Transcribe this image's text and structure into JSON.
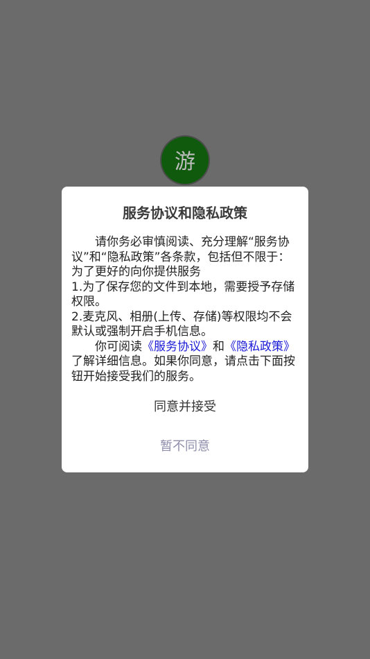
{
  "app": {
    "logo_text": "游"
  },
  "dialog": {
    "title": "服务协议和隐私政策",
    "paragraph1": "请你务必审慎阅读、充分理解“服务协议”和“隐私政策”各条款，包括但不限于：为了更好的向你提供服务",
    "line_storage": "1.为了保存您的文件到本地，需要授予存储权限。",
    "line_permissions": "2.麦克风、相册(上传、存储)等权限均不会默认或强制开启手机信息。",
    "read_prefix": "你可阅读",
    "service_link": "《服务协议》",
    "and_text": "和",
    "privacy_link": "《隐私政策》",
    "read_suffix": "了解详细信息。如果你同意，请点击下面按钮开始接受我们的服务。",
    "agree_label": "同意并接受",
    "disagree_label": "暂不同意"
  },
  "colors": {
    "overlay": "#6b6b6b",
    "logo_bg": "#0f5a0d",
    "link": "#1a1ad6",
    "disagree_text": "#8f8fad"
  }
}
